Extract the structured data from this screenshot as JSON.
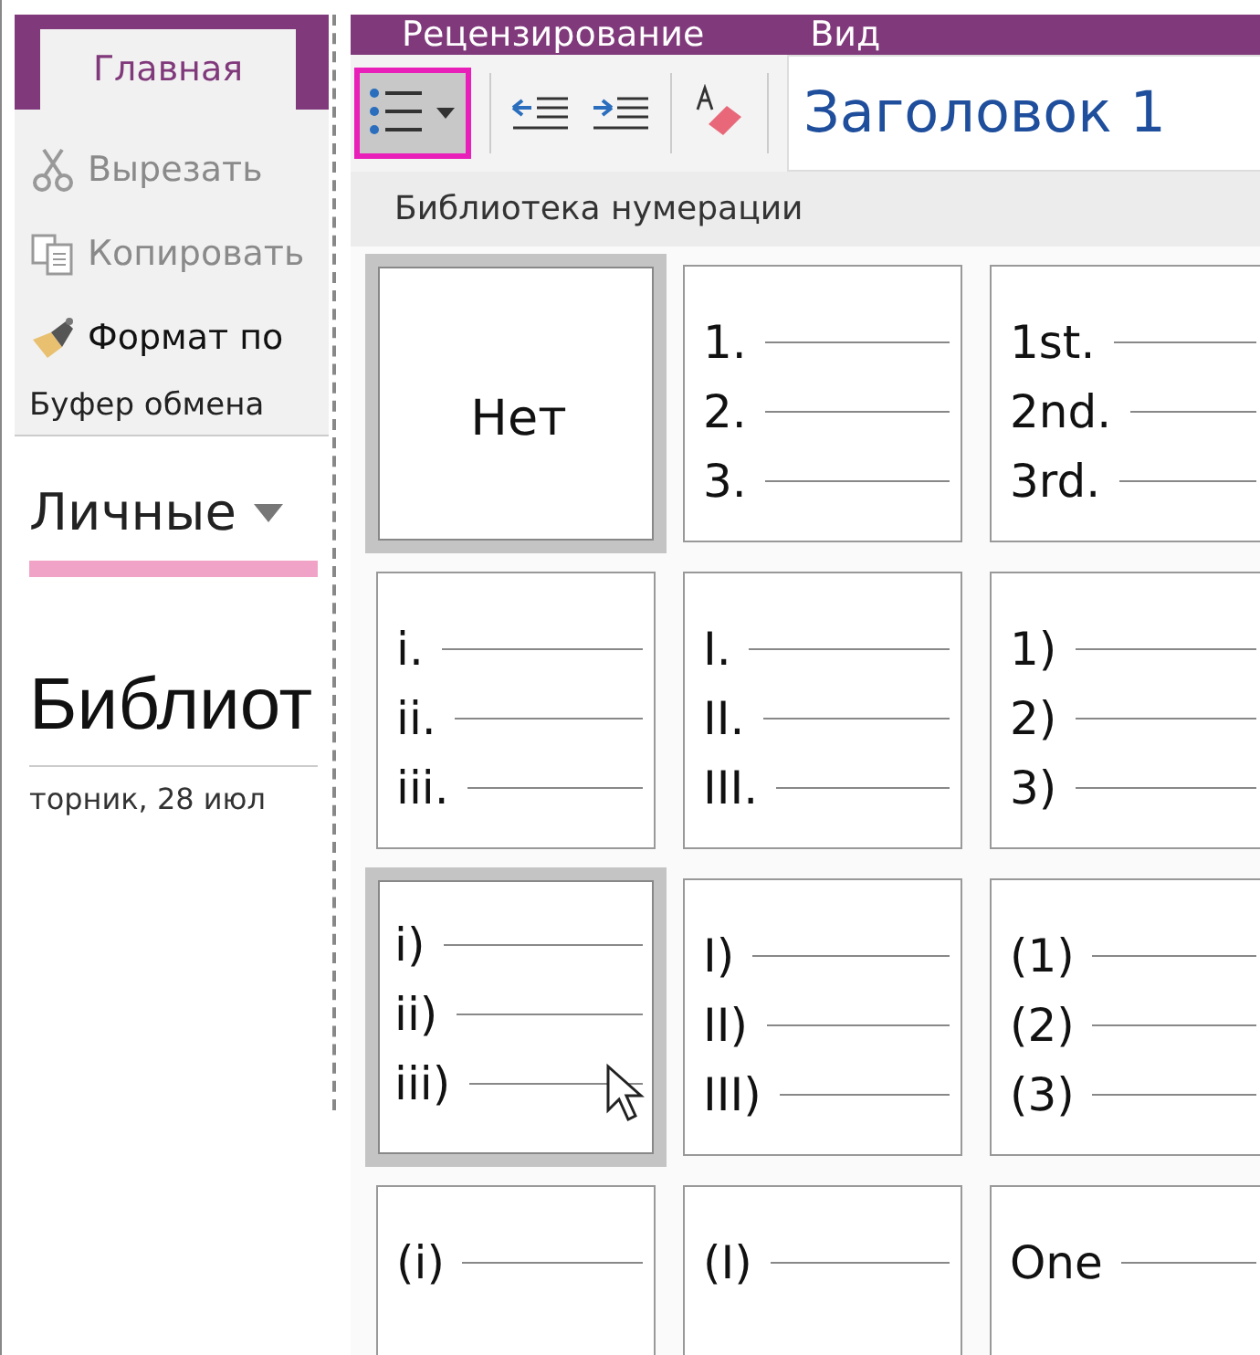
{
  "left_pane": {
    "tabs": [
      {
        "label": "Главная",
        "selected": true
      }
    ],
    "clipboard": {
      "items": [
        {
          "label": "Вырезать",
          "disabled": true
        },
        {
          "label": "Копировать",
          "disabled": true
        },
        {
          "label": "Формат по",
          "disabled": false
        }
      ],
      "group_label": "Буфер обмена"
    },
    "notebook": {
      "section": "Личные",
      "page_title": "Библиот",
      "page_date": "торник, 28 июл"
    }
  },
  "ribbon": {
    "tabs": [
      {
        "label": "Рецензирование",
        "selected": false
      },
      {
        "label": "Вид",
        "selected": false
      }
    ],
    "style_box": "Заголовок 1"
  },
  "numbering_menu": {
    "title": "Библиотека нумерации",
    "options": [
      {
        "kind": "none",
        "label": "Нет",
        "highlighted": true
      },
      {
        "kind": "list",
        "markers": [
          "1.",
          "2.",
          "3."
        ],
        "highlighted": false
      },
      {
        "kind": "list",
        "markers": [
          "1st.",
          "2nd.",
          "3rd."
        ],
        "highlighted": false
      },
      {
        "kind": "list",
        "markers": [
          "i.",
          "ii.",
          "iii."
        ],
        "highlighted": false
      },
      {
        "kind": "list",
        "markers": [
          "I.",
          "II.",
          "III."
        ],
        "highlighted": false
      },
      {
        "kind": "list",
        "markers": [
          "1)",
          "2)",
          "3)"
        ],
        "highlighted": false
      },
      {
        "kind": "list",
        "markers": [
          "i)",
          "ii)",
          "iii)"
        ],
        "highlighted": true
      },
      {
        "kind": "list",
        "markers": [
          "I)",
          "II)",
          "III)"
        ],
        "highlighted": false
      },
      {
        "kind": "list",
        "markers": [
          "(1)",
          "(2)",
          "(3)"
        ],
        "highlighted": false
      },
      {
        "kind": "list",
        "markers": [
          "(i)"
        ],
        "highlighted": false
      },
      {
        "kind": "list",
        "markers": [
          "(I)"
        ],
        "highlighted": false
      },
      {
        "kind": "list",
        "markers": [
          "One"
        ],
        "highlighted": false
      }
    ]
  }
}
